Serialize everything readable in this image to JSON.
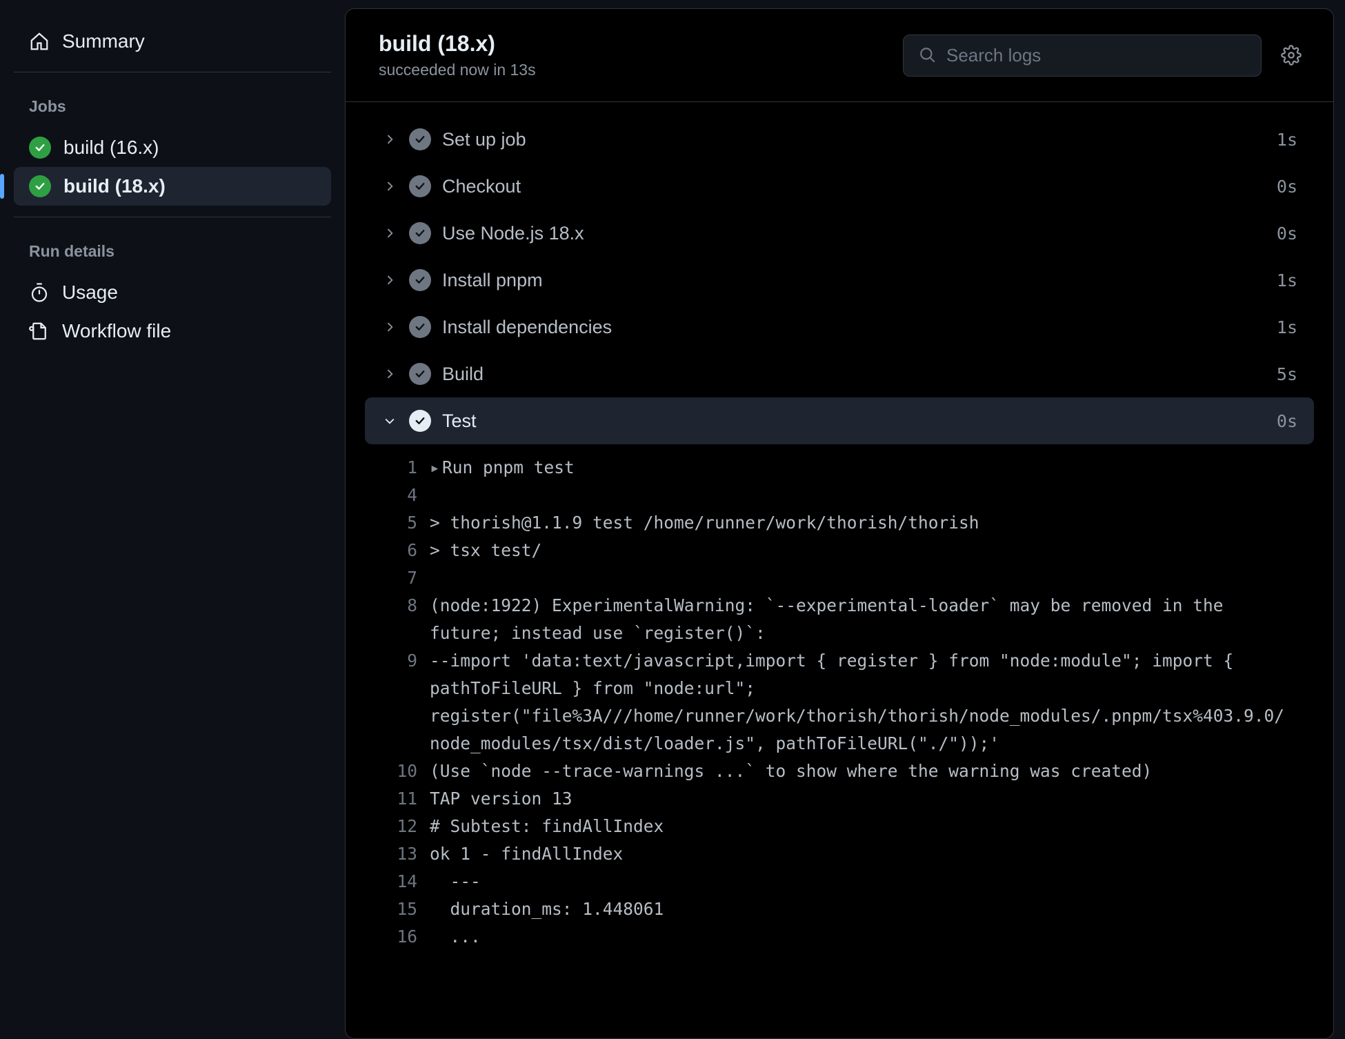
{
  "sidebar": {
    "summary_label": "Summary",
    "jobs_heading": "Jobs",
    "jobs": [
      {
        "label": "build (16.x)",
        "active": false
      },
      {
        "label": "build (18.x)",
        "active": true
      }
    ],
    "run_details_heading": "Run details",
    "details": [
      {
        "label": "Usage",
        "icon": "stopwatch"
      },
      {
        "label": "Workflow file",
        "icon": "workflow-file"
      }
    ]
  },
  "header": {
    "title": "build (18.x)",
    "subtitle": "succeeded now in 13s",
    "search_placeholder": "Search logs"
  },
  "steps": [
    {
      "name": "Set up job",
      "time": "1s",
      "expanded": false
    },
    {
      "name": "Checkout",
      "time": "0s",
      "expanded": false
    },
    {
      "name": "Use Node.js 18.x",
      "time": "0s",
      "expanded": false
    },
    {
      "name": "Install pnpm",
      "time": "1s",
      "expanded": false
    },
    {
      "name": "Install dependencies",
      "time": "1s",
      "expanded": false
    },
    {
      "name": "Build",
      "time": "5s",
      "expanded": false
    },
    {
      "name": "Test",
      "time": "0s",
      "expanded": true
    }
  ],
  "logs": [
    {
      "n": "1",
      "t": "Run pnpm test",
      "fold": true
    },
    {
      "n": "4",
      "t": ""
    },
    {
      "n": "5",
      "t": "> thorish@1.1.9 test /home/runner/work/thorish/thorish"
    },
    {
      "n": "6",
      "t": "> tsx test/"
    },
    {
      "n": "7",
      "t": ""
    },
    {
      "n": "8",
      "t": "(node:1922) ExperimentalWarning: `--experimental-loader` may be removed in the future; instead use `register()`:"
    },
    {
      "n": "9",
      "t": "--import 'data:text/javascript,import { register } from \"node:module\"; import { pathToFileURL } from \"node:url\"; register(\"file%3A///home/runner/work/thorish/thorish/node_modules/.pnpm/tsx%403.9.0/node_modules/tsx/dist/loader.js\", pathToFileURL(\"./\"));'"
    },
    {
      "n": "10",
      "t": "(Use `node --trace-warnings ...` to show where the warning was created)"
    },
    {
      "n": "11",
      "t": "TAP version 13"
    },
    {
      "n": "12",
      "t": "# Subtest: findAllIndex"
    },
    {
      "n": "13",
      "t": "ok 1 - findAllIndex"
    },
    {
      "n": "14",
      "t": "  ---"
    },
    {
      "n": "15",
      "t": "  duration_ms: 1.448061"
    },
    {
      "n": "16",
      "t": "  ..."
    }
  ]
}
